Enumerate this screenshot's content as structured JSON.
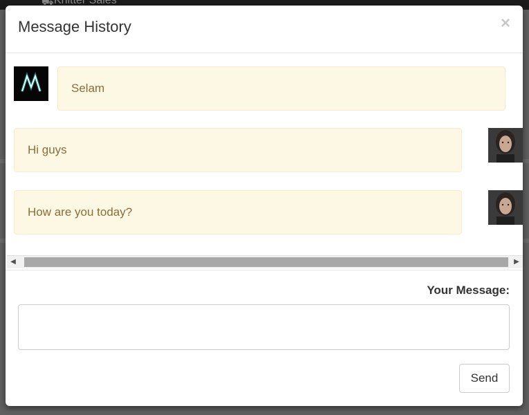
{
  "background": {
    "topbar_text": "Knitter Sales"
  },
  "modal": {
    "title": "Message History",
    "close_glyph": "×"
  },
  "messages": [
    {
      "text": "Selam",
      "avatar_icon": "dj-logo-avatar",
      "align": "left"
    },
    {
      "text": "Hi guys",
      "avatar_icon": "user-portrait-avatar",
      "align": "right"
    },
    {
      "text": "How are you today?",
      "avatar_icon": "user-portrait-avatar",
      "align": "right"
    }
  ],
  "scrollbar": {
    "left_arrow": "◀",
    "right_arrow": "▶"
  },
  "compose": {
    "label": "Your Message:",
    "input_value": "",
    "input_placeholder": "",
    "send_label": "Send"
  },
  "colors": {
    "bubble_bg": "#fcf8e3",
    "bubble_border": "#faebcc",
    "bubble_text": "#8a6d3b"
  }
}
